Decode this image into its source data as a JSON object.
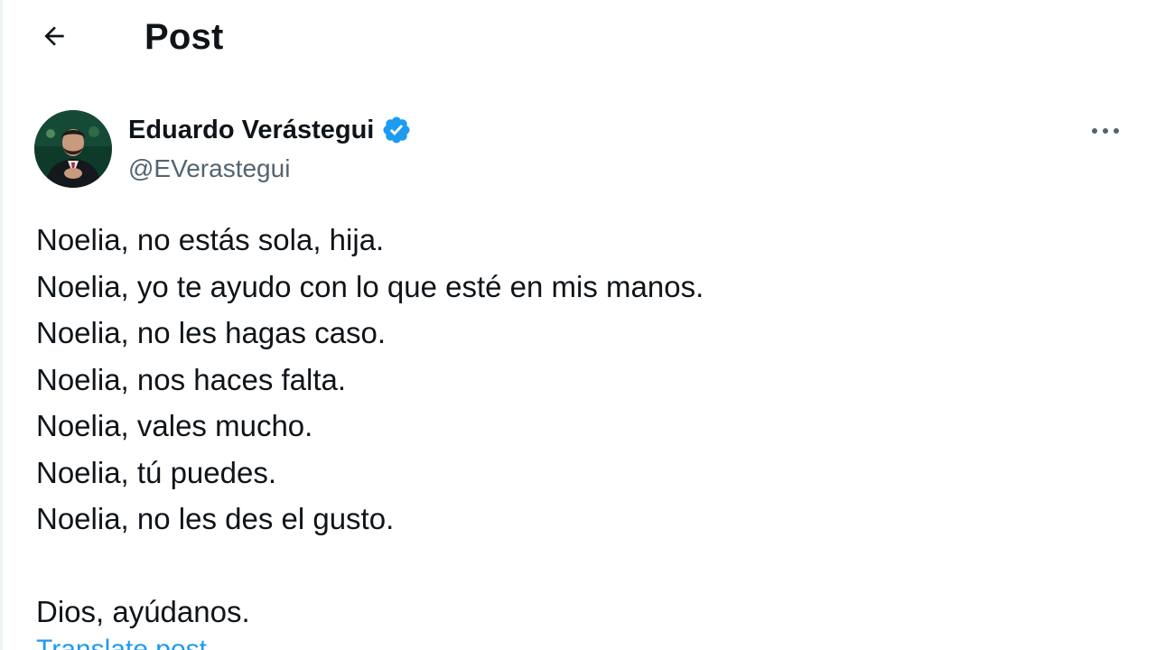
{
  "header": {
    "title": "Post",
    "back_icon": "arrow-left-icon"
  },
  "author": {
    "name": "Eduardo Verástegui",
    "handle": "@EVerastegui",
    "verified": true,
    "verified_color": "#1d9bf0"
  },
  "tweet": {
    "lines": [
      "Noelia, no estás sola, hija.",
      "Noelia, yo te ayudo con lo que esté en mis manos.",
      "Noelia, no les hagas caso.",
      "Noelia, nos haces falta.",
      "Noelia, vales mucho.",
      "Noelia, tú puedes.",
      "Noelia, no les des el gusto."
    ],
    "closing": "Dios, ayúdanos.",
    "translate_label": "Translate post"
  },
  "colors": {
    "text": "#0f1419",
    "secondary": "#536471",
    "accent": "#1d9bf0"
  }
}
